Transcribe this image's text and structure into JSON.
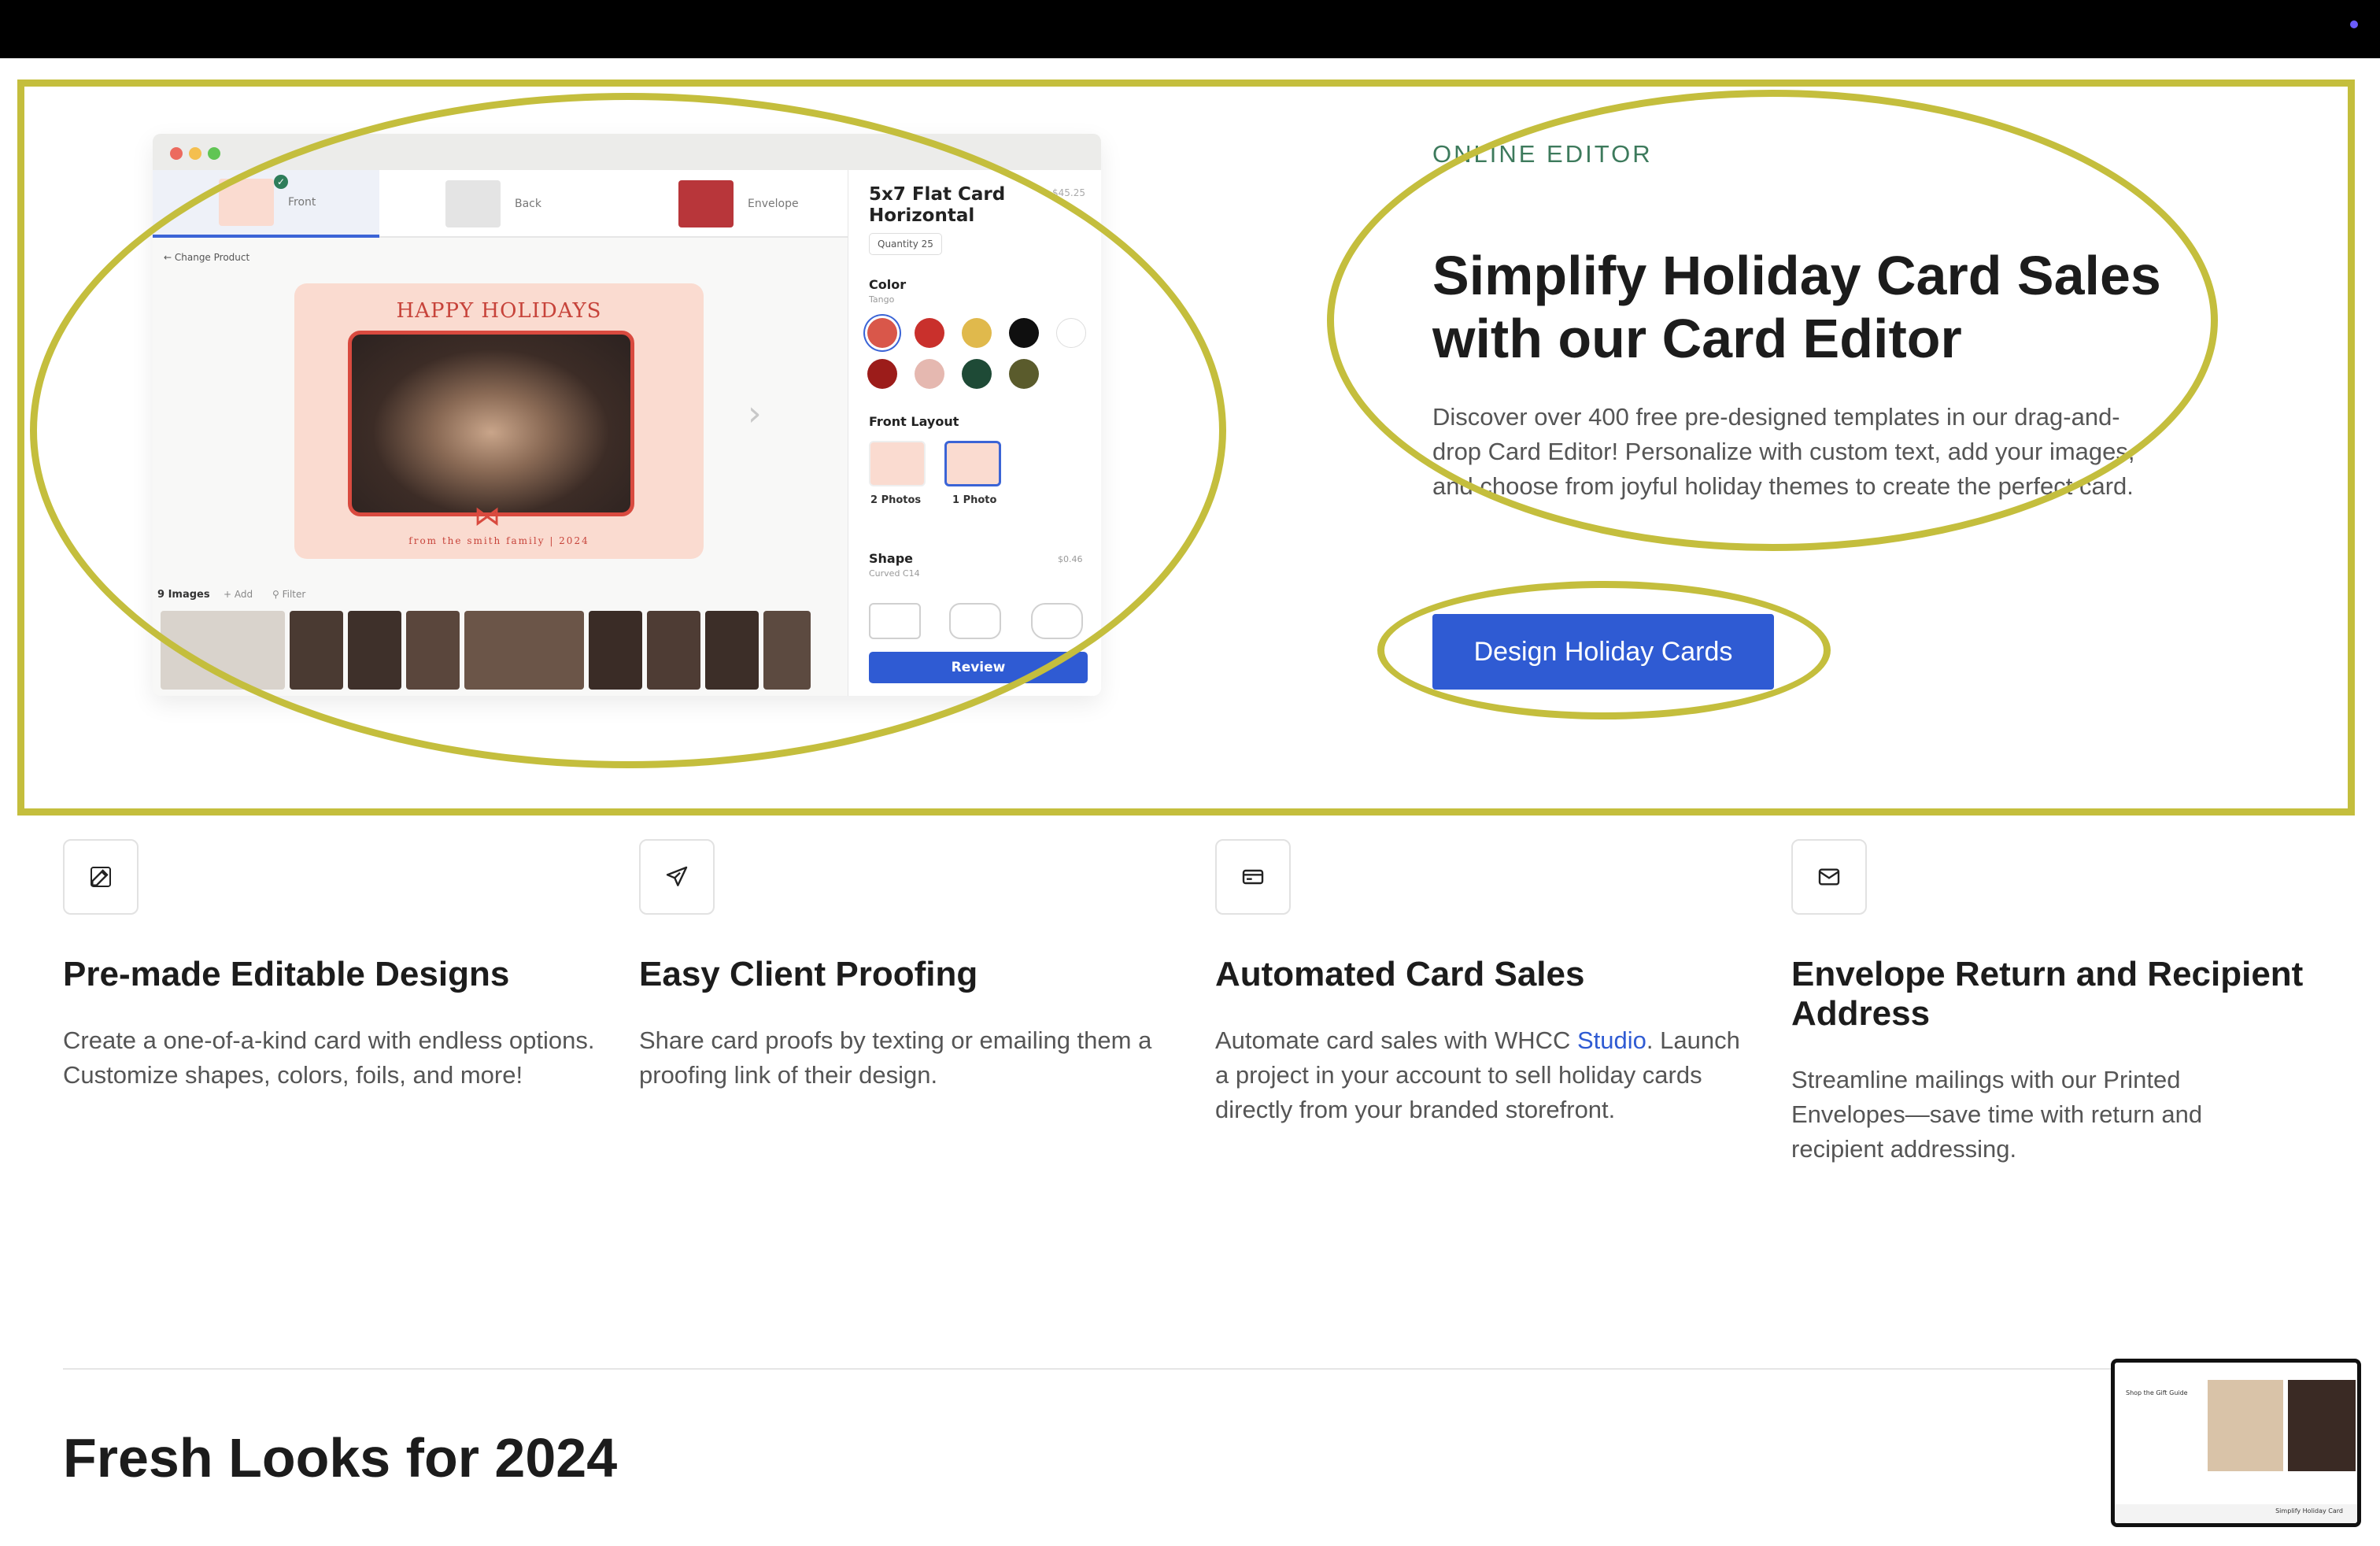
{
  "hero": {
    "eyebrow": "ONLINE EDITOR",
    "title": "Simplify Holiday Card Sales with our Card Editor",
    "description": "Discover over 400 free pre-designed templates in our drag-and-drop Card Editor! Personalize with custom text, add your images, and choose from joyful holiday themes to create the perfect card.",
    "cta_label": "Design Holiday Cards"
  },
  "editor_mockup": {
    "tabs": [
      {
        "label": "Front"
      },
      {
        "label": "Back"
      },
      {
        "label": "Envelope"
      }
    ],
    "change_product": "Change Product",
    "card_greeting": "HAPPY HOLIDAYS",
    "card_footer": "from the smith family | 2024",
    "images_label": "9 Images",
    "add_label": "Add",
    "filter_label": "Filter",
    "product_title": "5x7 Flat Card Horizontal",
    "product_price": "$45.25",
    "quantity": "Quantity 25",
    "color_heading": "Color",
    "color_selected": "Tango",
    "colors": [
      "#d9574a",
      "#c9302c",
      "#e0b94c",
      "#0f0f0f",
      "#ffffff",
      "#9c1c1a",
      "#e5b8b0",
      "#1e4a36",
      "#5a5b2c"
    ],
    "front_layout_heading": "Front Layout",
    "layouts": [
      {
        "label": "2 Photos"
      },
      {
        "label": "1 Photo"
      }
    ],
    "shape_heading": "Shape",
    "shape_selected": "Curved C14",
    "shape_price": "$0.46",
    "review_label": "Review"
  },
  "features": [
    {
      "icon": "edit-icon",
      "title": "Pre-made Editable Designs",
      "description": "Create a one-of-a-kind card with endless options. Customize shapes, colors, foils, and more!"
    },
    {
      "icon": "send-icon",
      "title": "Easy Client Proofing",
      "description": "Share card proofs by texting or emailing them a proofing link of their design."
    },
    {
      "icon": "card-icon",
      "title": "Automated Card Sales",
      "description_before": "Automate card sales with WHCC ",
      "description_link": "Studio",
      "description_after": ". Launch a project in your account to sell holiday cards directly from your branded storefront."
    },
    {
      "icon": "mail-icon",
      "title": "Envelope Return and Recipient Address",
      "description": "Streamline mailings with our Printed Envelopes—save time with return and recipient addressing."
    }
  ],
  "next_section_title": "Fresh Looks for 2024",
  "mini_preview": {
    "heading": "Shop the Gift Guide",
    "caption": "Simplify Holiday Card"
  },
  "colors": {
    "accent_blue": "#2f5bd3",
    "eyebrow_green": "#3d7a5c",
    "highlight_annotation": "#c4be3d"
  }
}
